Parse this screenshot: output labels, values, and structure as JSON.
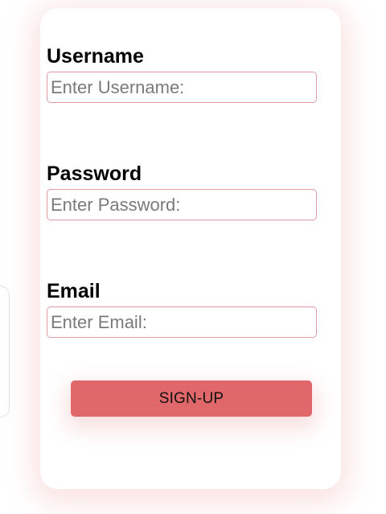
{
  "form": {
    "username": {
      "label": "Username",
      "placeholder": "Enter Username:",
      "value": ""
    },
    "password": {
      "label": "Password",
      "placeholder": "Enter Password:",
      "value": ""
    },
    "email": {
      "label": "Email",
      "placeholder": "Enter Email:",
      "value": ""
    },
    "submit_label": "SIGN-UP"
  },
  "colors": {
    "button_background": "#e1686a",
    "input_border": "#e29aa2",
    "card_shadow": "#ee8080"
  }
}
